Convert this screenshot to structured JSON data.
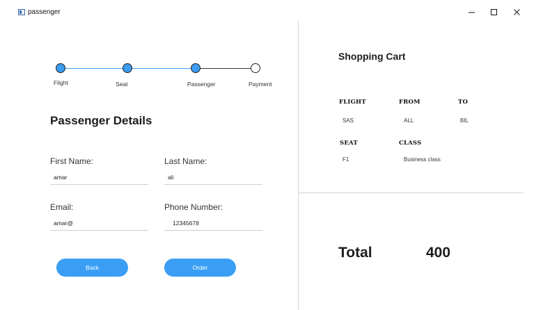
{
  "window": {
    "title": "passenger",
    "controls": [
      "minimize-icon",
      "maximize-icon",
      "close-icon"
    ]
  },
  "stepper": {
    "steps": [
      {
        "label": "Flight",
        "state": "done"
      },
      {
        "label": "Seat",
        "state": "done"
      },
      {
        "label": "Passenger",
        "state": "current"
      },
      {
        "label": "Payment",
        "state": "pending"
      }
    ],
    "active_color": "#3b9cf0"
  },
  "form": {
    "title": "Passenger Details",
    "first_name": {
      "label": "First Name:",
      "value": "amar"
    },
    "last_name": {
      "label": "Last Name:",
      "value": "ali"
    },
    "email": {
      "label": "Email:",
      "value": "amar@"
    },
    "phone": {
      "label": "Phone Number:",
      "value": "12345678"
    },
    "back_label": "Back",
    "order_label": "Order",
    "button_color": "#3a9ef5"
  },
  "cart": {
    "title": "Shopping Cart",
    "headers": {
      "flight": "FLIGHT",
      "from": "FROM",
      "to": "TO",
      "seat": "SEAT",
      "class": "CLASS"
    },
    "values": {
      "flight": "SAS",
      "from": "ALL",
      "to": "BIL",
      "seat": "F1",
      "class": "Business class"
    },
    "total_label": "Total",
    "total_value": "400"
  }
}
